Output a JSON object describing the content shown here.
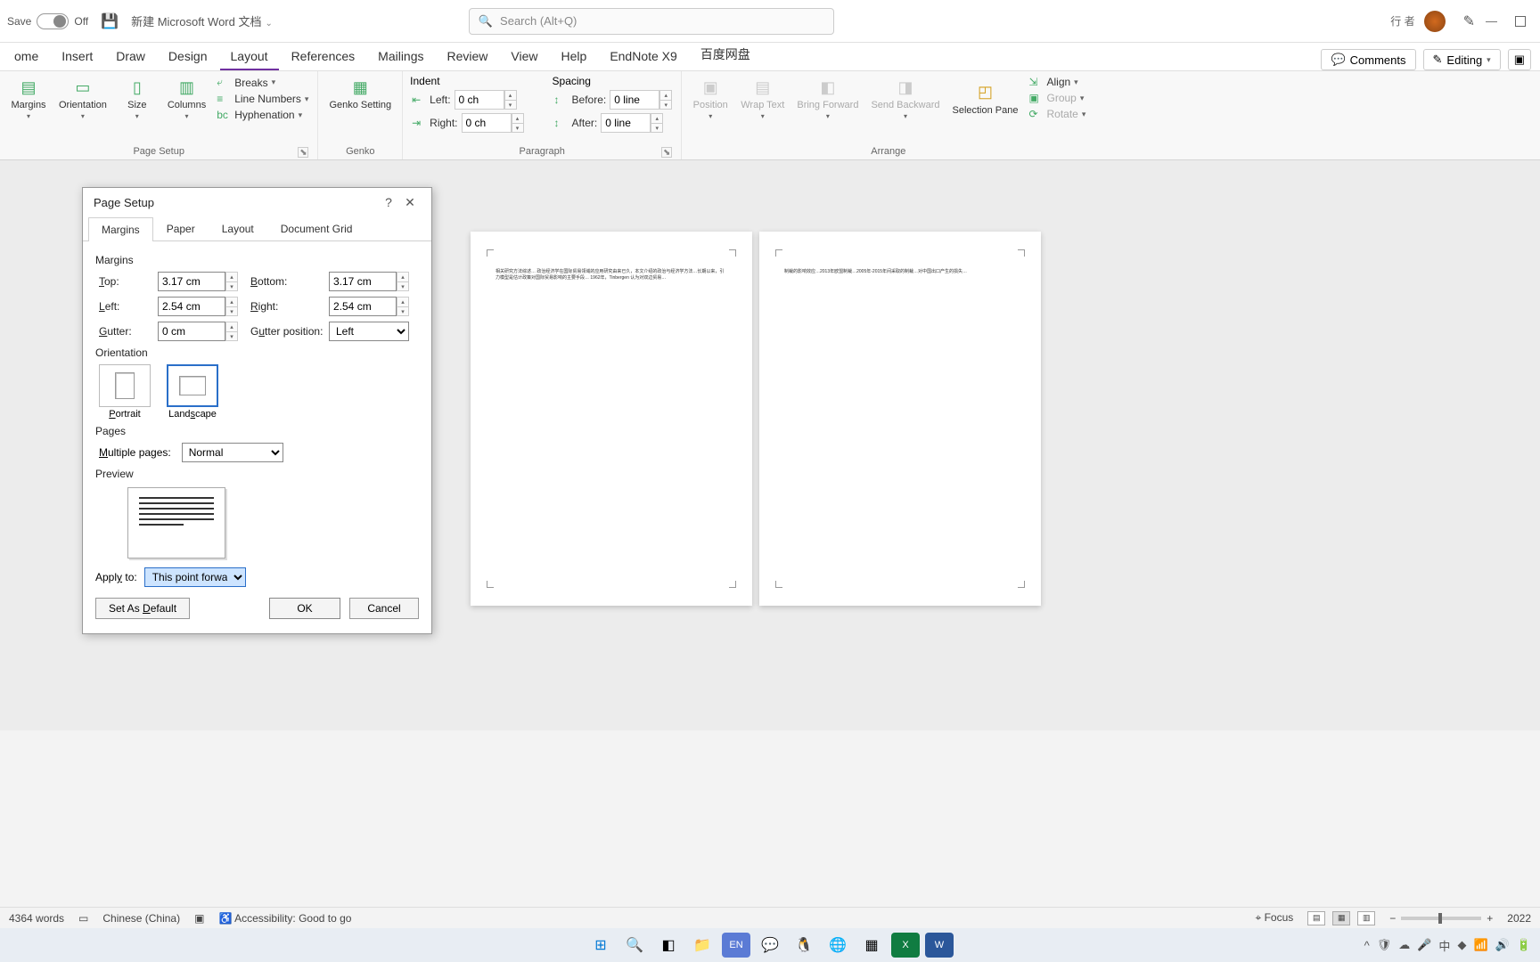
{
  "title_bar": {
    "autosave_label": "Save",
    "autosave_state": "Off",
    "doc_title": "新建 Microsoft Word 文档",
    "search_placeholder": "Search (Alt+Q)",
    "user_name": "行 者",
    "comments_label": "Comments",
    "editing_label": "Editing"
  },
  "tabs": [
    "ome",
    "Insert",
    "Draw",
    "Design",
    "Layout",
    "References",
    "Mailings",
    "Review",
    "View",
    "Help",
    "EndNote X9",
    "百度网盘"
  ],
  "active_tab": "Layout",
  "ribbon": {
    "page_setup": {
      "label": "Page Setup",
      "margins": "Margins",
      "orientation": "Orientation",
      "size": "Size",
      "columns": "Columns",
      "breaks": "Breaks",
      "line_numbers": "Line Numbers",
      "hyphenation": "Hyphenation"
    },
    "genko": {
      "label": "Genko",
      "btn": "Genko Setting"
    },
    "paragraph": {
      "label": "Paragraph",
      "indent": "Indent",
      "left": "Left:",
      "right": "Right:",
      "left_val": "0 ch",
      "right_val": "0 ch",
      "spacing": "Spacing",
      "before": "Before:",
      "after": "After:",
      "before_val": "0 line",
      "after_val": "0 line"
    },
    "arrange": {
      "label": "Arrange",
      "position": "Position",
      "wrap": "Wrap Text",
      "bring": "Bring Forward",
      "send": "Send Backward",
      "selection": "Selection Pane",
      "align": "Align",
      "group": "Group",
      "rotate": "Rotate"
    }
  },
  "dialog": {
    "title": "Page Setup",
    "tabs": [
      "Margins",
      "Paper",
      "Layout",
      "Document Grid"
    ],
    "active_tab": "Margins",
    "section_margins": "Margins",
    "top": "Top:",
    "top_val": "3.17 cm",
    "bottom": "Bottom:",
    "bottom_val": "3.17 cm",
    "left": "Left:",
    "left_val": "2.54 cm",
    "right": "Right:",
    "right_val": "2.54 cm",
    "gutter": "Gutter:",
    "gutter_val": "0 cm",
    "gutter_pos": "Gutter position:",
    "gutter_pos_val": "Left",
    "section_orientation": "Orientation",
    "portrait": "Portrait",
    "landscape": "Landscape",
    "selected_orientation": "Landscape",
    "section_pages": "Pages",
    "multiple_pages": "Multiple pages:",
    "multiple_pages_val": "Normal",
    "section_preview": "Preview",
    "apply_to": "Apply to:",
    "apply_to_val": "This point forward",
    "set_default": "Set As Default",
    "ok": "OK",
    "cancel": "Cancel"
  },
  "status": {
    "words": "4364 words",
    "language": "Chinese (China)",
    "accessibility": "Accessibility: Good to go",
    "focus": "Focus",
    "year": "2022"
  },
  "document": {
    "page1_sample": "相关研究方法综述… 政治经济学在国际贸易领域的应用研究由来已久，本文介绍的政治与经济学方法…长期以来，引力模型是估计政策对国际贸易影响的主要手段… 1962年，Tinbergen 认为对双边贸易…",
    "page2_sample": "制裁的影响效应…2013年欧盟制裁…2005年-2015年间采取的制裁…对中国出口产生的损失…"
  }
}
